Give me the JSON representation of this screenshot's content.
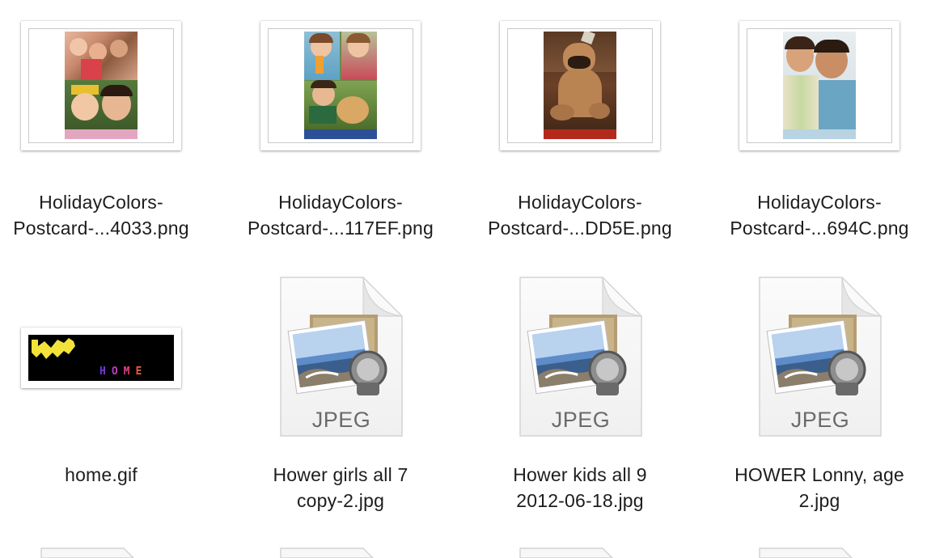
{
  "files": [
    {
      "line1": "HolidayColors-",
      "line2": "Postcard-...4033.png",
      "kind": "postcard-collage-pink"
    },
    {
      "line1": "HolidayColors-",
      "line2": "Postcard-...117EF.png",
      "kind": "postcard-collage-blue"
    },
    {
      "line1": "HolidayColors-",
      "line2": "Postcard-...DD5E.png",
      "kind": "postcard-dog"
    },
    {
      "line1": "HolidayColors-",
      "line2": "Postcard-...694C.png",
      "kind": "postcard-family"
    },
    {
      "line1": "home.gif",
      "line2": "",
      "kind": "gif-home"
    },
    {
      "line1": "Hower girls all 7",
      "line2": "copy-2.jpg",
      "kind": "jpeg"
    },
    {
      "line1": "Hower kids all 9",
      "line2": "2012-06-18.jpg",
      "kind": "jpeg"
    },
    {
      "line1": "HOWER Lonny, age",
      "line2": "2.jpg",
      "kind": "jpeg"
    }
  ],
  "jpeg_badge": "JPEG",
  "gif_text": "HOME",
  "colors": {
    "band_pink": "#e3a6c0",
    "band_blue": "#2d4f95",
    "band_red": "#b32a1c",
    "band_lightblue": "#b8d3e2",
    "label_text": "#1d1d1d",
    "jpeg_text": "#6b6b6b"
  }
}
